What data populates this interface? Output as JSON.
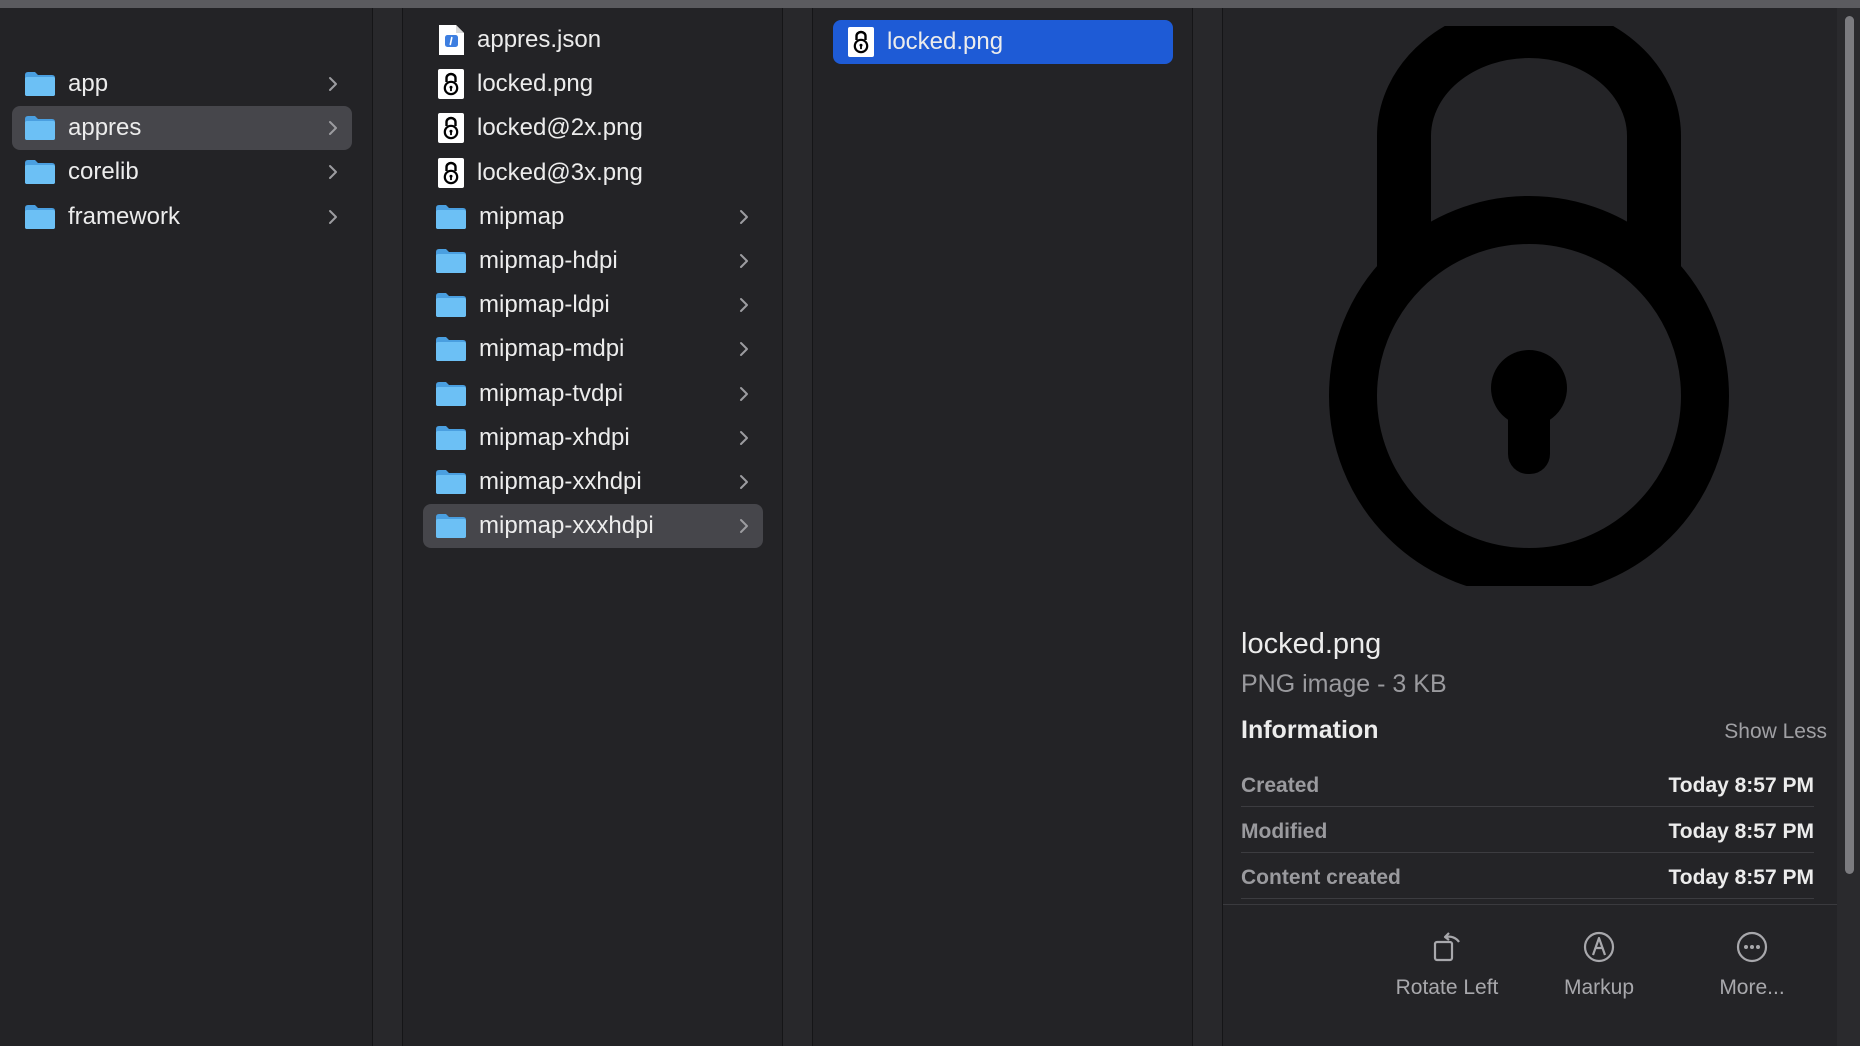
{
  "columns": {
    "col1": {
      "items": [
        {
          "label": "app",
          "kind": "folder",
          "has_children": true,
          "selected": false
        },
        {
          "label": "appres",
          "kind": "folder",
          "has_children": true,
          "selected": true
        },
        {
          "label": "corelib",
          "kind": "folder",
          "has_children": true,
          "selected": false
        },
        {
          "label": "framework",
          "kind": "folder",
          "has_children": true,
          "selected": false
        }
      ]
    },
    "col2": {
      "items": [
        {
          "label": "appres.json",
          "kind": "json-file",
          "has_children": false,
          "selected": false
        },
        {
          "label": "locked.png",
          "kind": "image-file",
          "has_children": false,
          "selected": false
        },
        {
          "label": "locked@2x.png",
          "kind": "image-file",
          "has_children": false,
          "selected": false
        },
        {
          "label": "locked@3x.png",
          "kind": "image-file",
          "has_children": false,
          "selected": false
        },
        {
          "label": "mipmap",
          "kind": "folder",
          "has_children": true,
          "selected": false
        },
        {
          "label": "mipmap-hdpi",
          "kind": "folder",
          "has_children": true,
          "selected": false
        },
        {
          "label": "mipmap-ldpi",
          "kind": "folder",
          "has_children": true,
          "selected": false
        },
        {
          "label": "mipmap-mdpi",
          "kind": "folder",
          "has_children": true,
          "selected": false
        },
        {
          "label": "mipmap-tvdpi",
          "kind": "folder",
          "has_children": true,
          "selected": false
        },
        {
          "label": "mipmap-xhdpi",
          "kind": "folder",
          "has_children": true,
          "selected": false
        },
        {
          "label": "mipmap-xxhdpi",
          "kind": "folder",
          "has_children": true,
          "selected": false
        },
        {
          "label": "mipmap-xxxhdpi",
          "kind": "folder",
          "has_children": true,
          "selected": true
        }
      ]
    },
    "col3": {
      "items": [
        {
          "label": "locked.png",
          "kind": "image-file",
          "has_children": false,
          "selected": true
        }
      ]
    }
  },
  "preview": {
    "image_icon": "padlock-icon",
    "filename": "locked.png",
    "kind_size": "PNG image - 3 KB",
    "info_heading": "Information",
    "show_less_label": "Show Less",
    "info": [
      {
        "key": "Created",
        "value": "Today 8:57 PM"
      },
      {
        "key": "Modified",
        "value": "Today 8:57 PM"
      },
      {
        "key": "Content created",
        "value": "Today 8:57 PM"
      }
    ],
    "actions": [
      {
        "label": "Rotate Left",
        "icon": "rotate-left-icon"
      },
      {
        "label": "Markup",
        "icon": "markup-icon"
      },
      {
        "label": "More...",
        "icon": "more-icon"
      }
    ]
  },
  "colors": {
    "accent_selection": "#1e5bd6",
    "gray_selection": "#46464b",
    "folder_blue": "#5ab3f0"
  }
}
